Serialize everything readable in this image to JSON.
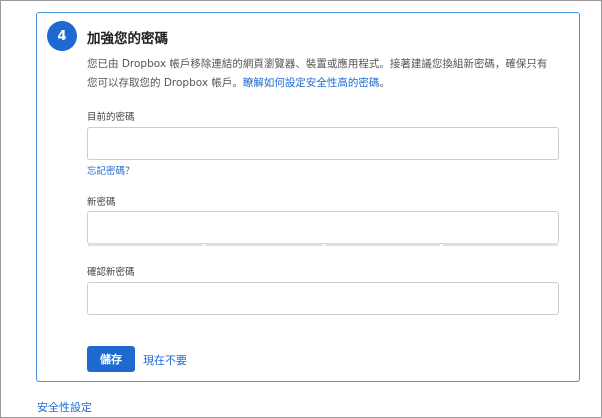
{
  "step": {
    "number": "4",
    "title": "加強您的密碼",
    "description": "您已由 Dropbox 帳戶移除連結的網頁瀏覽器、裝置或應用程式。接著建議您換組新密碼，確保只有您可以存取您的 Dropbox 帳戶。",
    "learn_more_link": "瞭解如何設定安全性高的密碼",
    "description_end": "。"
  },
  "form": {
    "current_password_label": "目前的密碼",
    "current_password_value": "",
    "forgot_password_link": "忘記密碼？",
    "new_password_label": "新密碼",
    "new_password_value": "",
    "confirm_password_label": "確認新密碼",
    "confirm_password_value": "",
    "save_button": "儲存",
    "not_now_link": "現在不要"
  },
  "footer": {
    "security_settings_link": "安全性設定"
  },
  "colors": {
    "accent": "#1e6ad0",
    "card_border": "#4a90e2",
    "input_border": "#c9ced6"
  }
}
